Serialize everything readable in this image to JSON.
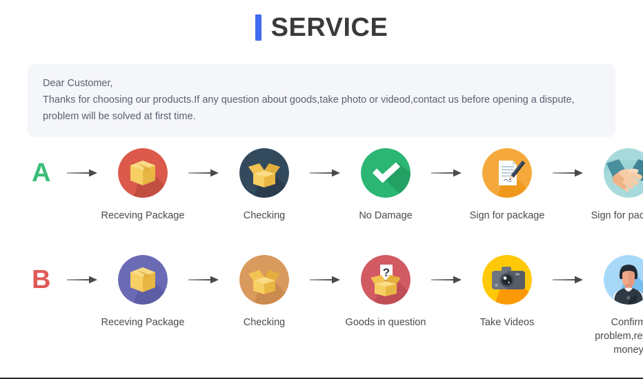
{
  "header": {
    "title": "SERVICE",
    "accent_color": "#4169f2"
  },
  "notice": {
    "background": "#f5f6fa",
    "text_color": "#5a6072",
    "lines": [
      "Dear Customer,",
      "Thanks for choosing our products.If any question about goods,take photo or videod,contact us before opening a dispute,",
      "problem will be solved at first time."
    ]
  },
  "flows": [
    {
      "letter": "A",
      "letter_color": "#3bbd79",
      "steps": [
        {
          "label": "Receving Package",
          "icon": "package-box-icon",
          "circle_color": "#db5a4b",
          "shadow_color": "#c24e41"
        },
        {
          "label": "Checking",
          "icon": "open-box-icon",
          "circle_color": "#33495c",
          "shadow_color": "#2a3c4d"
        },
        {
          "label": "No Damage",
          "icon": "check-mark-icon",
          "circle_color": "#2bb673",
          "shadow_color": "#23a064"
        },
        {
          "label": "Sign for package",
          "icon": "document-pen-icon",
          "circle_color": "#f5a93c",
          "shadow_color": "#f0981c"
        },
        {
          "label": "Sign for package",
          "icon": "handshake-icon",
          "circle_color": "#a8dadc",
          "shadow_color": "#96cdd0"
        }
      ]
    },
    {
      "letter": "B",
      "letter_color": "#e05a57",
      "steps": [
        {
          "label": "Receving Package",
          "icon": "package-box-icon",
          "circle_color": "#6b6bb5",
          "shadow_color": "#5d5da6"
        },
        {
          "label": "Checking",
          "icon": "open-box-icon",
          "circle_color": "#d99a5e",
          "shadow_color": "#cb8a4e"
        },
        {
          "label": "Goods in question",
          "icon": "question-box-icon",
          "circle_color": "#d15a63",
          "shadow_color": "#bf4d56"
        },
        {
          "label": "Take Videos",
          "icon": "camera-icon",
          "circle_color": "#ffc907",
          "shadow_color": "#fb9a06"
        },
        {
          "label": "Confirm problem,refund money",
          "icon": "support-person-icon",
          "circle_color": "#a8d8f8",
          "shadow_color": "#78bdf2"
        }
      ]
    }
  ],
  "arrow": {
    "name": "arrow-right-icon",
    "color": "#4a4a4a"
  }
}
